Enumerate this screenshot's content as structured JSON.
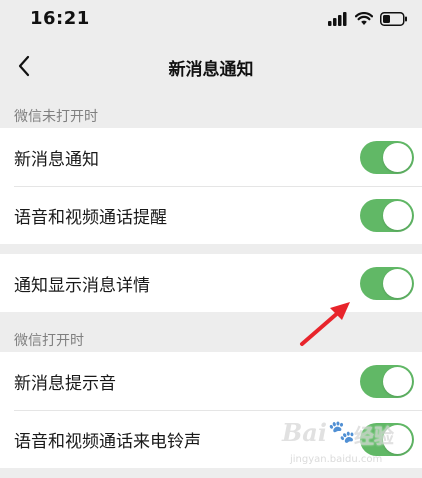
{
  "status_bar": {
    "time": "16:21"
  },
  "nav": {
    "title": "新消息通知"
  },
  "sections": {
    "closed_label": "微信未打开时",
    "opened_label": "微信打开时"
  },
  "rows": {
    "new_message_notify": {
      "label": "新消息通知",
      "enabled": true
    },
    "voice_video_reminder": {
      "label": "语音和视频通话提醒",
      "enabled": true
    },
    "show_details": {
      "label": "通知显示消息详情",
      "enabled": true
    },
    "new_message_sound": {
      "label": "新消息提示音",
      "enabled": true
    },
    "voice_video_ringtone": {
      "label": "语音和视频通话来电铃声",
      "enabled": true
    }
  },
  "watermark": {
    "brand": "Bai",
    "brand2": "经验",
    "sub": "jingyan.baidu.com"
  },
  "colors": {
    "toggle_on": "#61b866",
    "background": "#ededed",
    "annotation_arrow": "#e8242b"
  }
}
